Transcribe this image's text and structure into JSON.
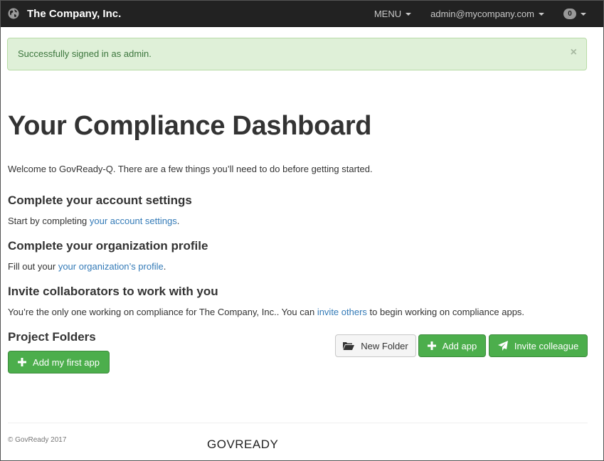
{
  "navbar": {
    "brand": "The Company, Inc.",
    "brand_icon": "globe-icon",
    "menu_label": "MENU",
    "user_label": "admin@mycompany.com",
    "notifications_count": "0"
  },
  "alert": {
    "message": "Successfully signed in as admin.",
    "close_label": "×"
  },
  "main": {
    "title": "Your Compliance Dashboard",
    "welcome": "Welcome to GovReady-Q. There are a few things you’ll need to do before getting started.",
    "account": {
      "heading": "Complete your account settings",
      "text_before": "Start by completing ",
      "link": "your account settings",
      "text_after": "."
    },
    "organization": {
      "heading": "Complete your organization profile",
      "text_before": "Fill out your ",
      "link": "your organization’s profile",
      "text_after": "."
    },
    "invite": {
      "heading": "Invite collaborators to work with you",
      "text_before": "You’re the only one working on compliance for The Company, Inc.. You can ",
      "link": "invite others",
      "text_after": " to begin working on compliance apps."
    },
    "projects": {
      "heading": "Project Folders",
      "add_first_app": "Add my first app",
      "new_folder": "New Folder",
      "add_app": "Add app",
      "invite_colleague": "Invite colleague"
    }
  },
  "footer": {
    "copyright": "© GovReady 2017",
    "logo": "GOVREADY"
  },
  "colors": {
    "navbar": "#222222",
    "success": "#4cae4c",
    "link": "#337ab7",
    "alert_bg": "#dff0d8",
    "alert_text": "#3c763d"
  }
}
